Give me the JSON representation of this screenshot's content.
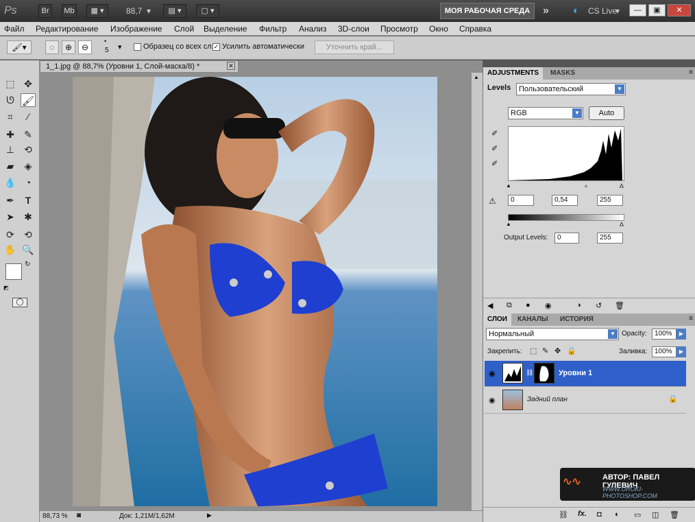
{
  "appbar": {
    "ps": "Ps",
    "br": "Br",
    "mb": "Mb",
    "zoom": "88,7",
    "workspace": "МОЯ РАБОЧАЯ СРЕДА",
    "more": "»",
    "cslive": "CS Live",
    "min": "—",
    "restore": "▣",
    "close": "✕"
  },
  "menu": [
    "Файл",
    "Редактирование",
    "Изображение",
    "Слой",
    "Выделение",
    "Фильтр",
    "Анализ",
    "3D-слои",
    "Просмотр",
    "Окно",
    "Справка"
  ],
  "options": {
    "brush_size": "5",
    "sample_all": "Образец со всех сл.",
    "sample_all_checked": false,
    "auto_enhance": "Усилить автоматически",
    "auto_enhance_checked": true,
    "refine": "Уточнить край..."
  },
  "document": {
    "tab": "1_1.jpg @ 88,7% (Уровни 1, Слой-маска/8) *",
    "tab_close": "✕",
    "zoom": "88,73 %",
    "doc_info": "Док: 1,21M/1,62M"
  },
  "adjustments": {
    "tab_adj": "ADJUSTMENTS",
    "tab_masks": "MASKS",
    "title": "Levels",
    "preset": "Пользовательский",
    "channel": "RGB",
    "auto": "Auto",
    "input_black": "0",
    "input_gamma": "0,54",
    "input_white": "255",
    "output_label": "Output Levels:",
    "output_black": "0",
    "output_white": "255"
  },
  "layers": {
    "tab_layers": "СЛОИ",
    "tab_channels": "КАНАЛЫ",
    "tab_history": "ИСТОРИЯ",
    "blend": "Нормальный",
    "opacity_label": "Opacity:",
    "opacity": "100%",
    "lock_label": "Закрепить:",
    "fill_label": "Заливка:",
    "fill": "100%",
    "items": [
      {
        "name": "Уровни 1",
        "selected": true
      },
      {
        "name": "Задний план",
        "selected": false
      }
    ]
  },
  "watermark": {
    "author": "АВТОР: ПАВЕЛ ГУЛЕВИЧ",
    "site": "WWW.UROKI-PHOTOSHOP.COM"
  },
  "colors": {
    "accent": "#1f4fc4",
    "selected_layer": "#2f5fc8"
  }
}
